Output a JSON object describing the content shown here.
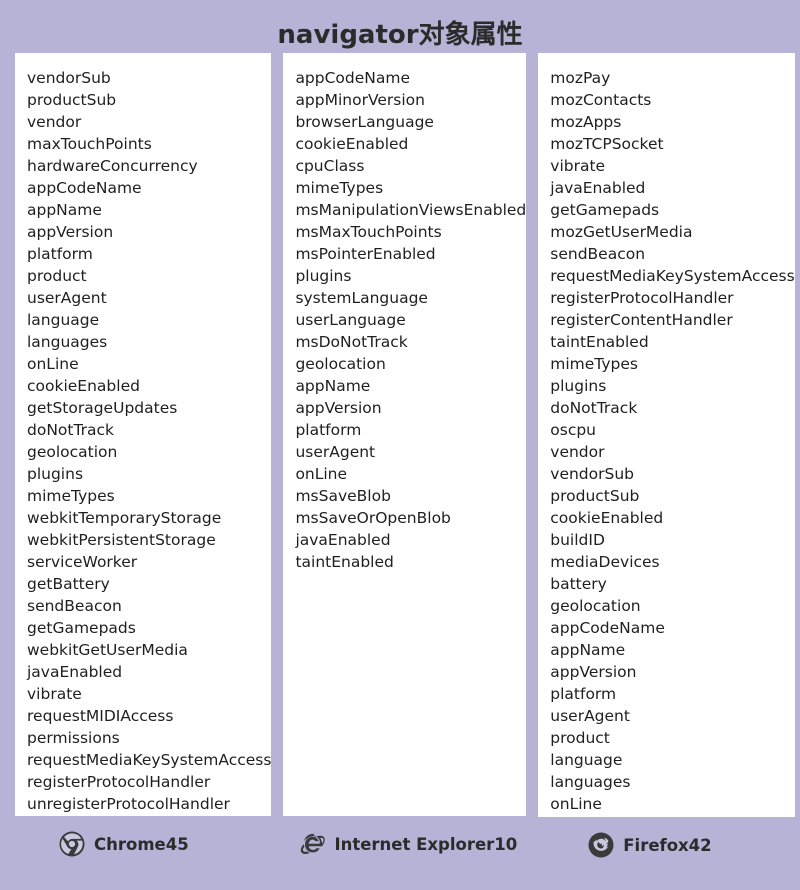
{
  "page": {
    "title": "navigator对象属性",
    "background_color": "#b7b3d7",
    "panel_color": "#ffffff",
    "text_color": "#1f1f1f"
  },
  "columns": [
    {
      "browser": {
        "name": "Chrome45",
        "icon": "chrome-icon"
      },
      "properties": [
        "vendorSub",
        "productSub",
        "vendor",
        "maxTouchPoints",
        "hardwareConcurrency",
        "appCodeName",
        "appName",
        "appVersion",
        "platform",
        "product",
        "userAgent",
        "language",
        "languages",
        "onLine",
        "cookieEnabled",
        "getStorageUpdates",
        "doNotTrack",
        "geolocation",
        "plugins",
        "mimeTypes",
        "webkitTemporaryStorage",
        "webkitPersistentStorage",
        "serviceWorker",
        "getBattery",
        "sendBeacon",
        "getGamepads",
        "webkitGetUserMedia",
        "javaEnabled",
        "vibrate",
        "requestMIDIAccess",
        "permissions",
        "requestMediaKeySystemAccess",
        "registerProtocolHandler",
        "unregisterProtocolHandler"
      ]
    },
    {
      "browser": {
        "name": "Internet Explorer10",
        "icon": "internet-explorer-icon"
      },
      "properties": [
        "appCodeName",
        "appMinorVersion",
        "browserLanguage",
        "cookieEnabled",
        "cpuClass",
        "mimeTypes",
        "msManipulationViewsEnabled",
        "msMaxTouchPoints",
        "msPointerEnabled",
        "plugins",
        "systemLanguage",
        "userLanguage",
        "msDoNotTrack",
        "geolocation",
        "appName",
        "appVersion",
        "platform",
        "userAgent",
        "onLine",
        "msSaveBlob",
        "msSaveOrOpenBlob",
        "javaEnabled",
        "taintEnabled"
      ]
    },
    {
      "browser": {
        "name": "Firefox42",
        "icon": "firefox-icon"
      },
      "properties": [
        "mozPay",
        "mozContacts",
        "mozApps",
        "mozTCPSocket",
        "vibrate",
        "javaEnabled",
        "getGamepads",
        "mozGetUserMedia",
        "sendBeacon",
        "requestMediaKeySystemAccess",
        "registerProtocolHandler",
        "registerContentHandler",
        "taintEnabled",
        "mimeTypes",
        "plugins",
        "doNotTrack",
        "oscpu",
        "vendor",
        "vendorSub",
        "productSub",
        "cookieEnabled",
        "buildID",
        "mediaDevices",
        "battery",
        "geolocation",
        "appCodeName",
        "appName",
        "appVersion",
        "platform",
        "userAgent",
        "product",
        "language",
        "languages",
        "onLine"
      ]
    }
  ]
}
